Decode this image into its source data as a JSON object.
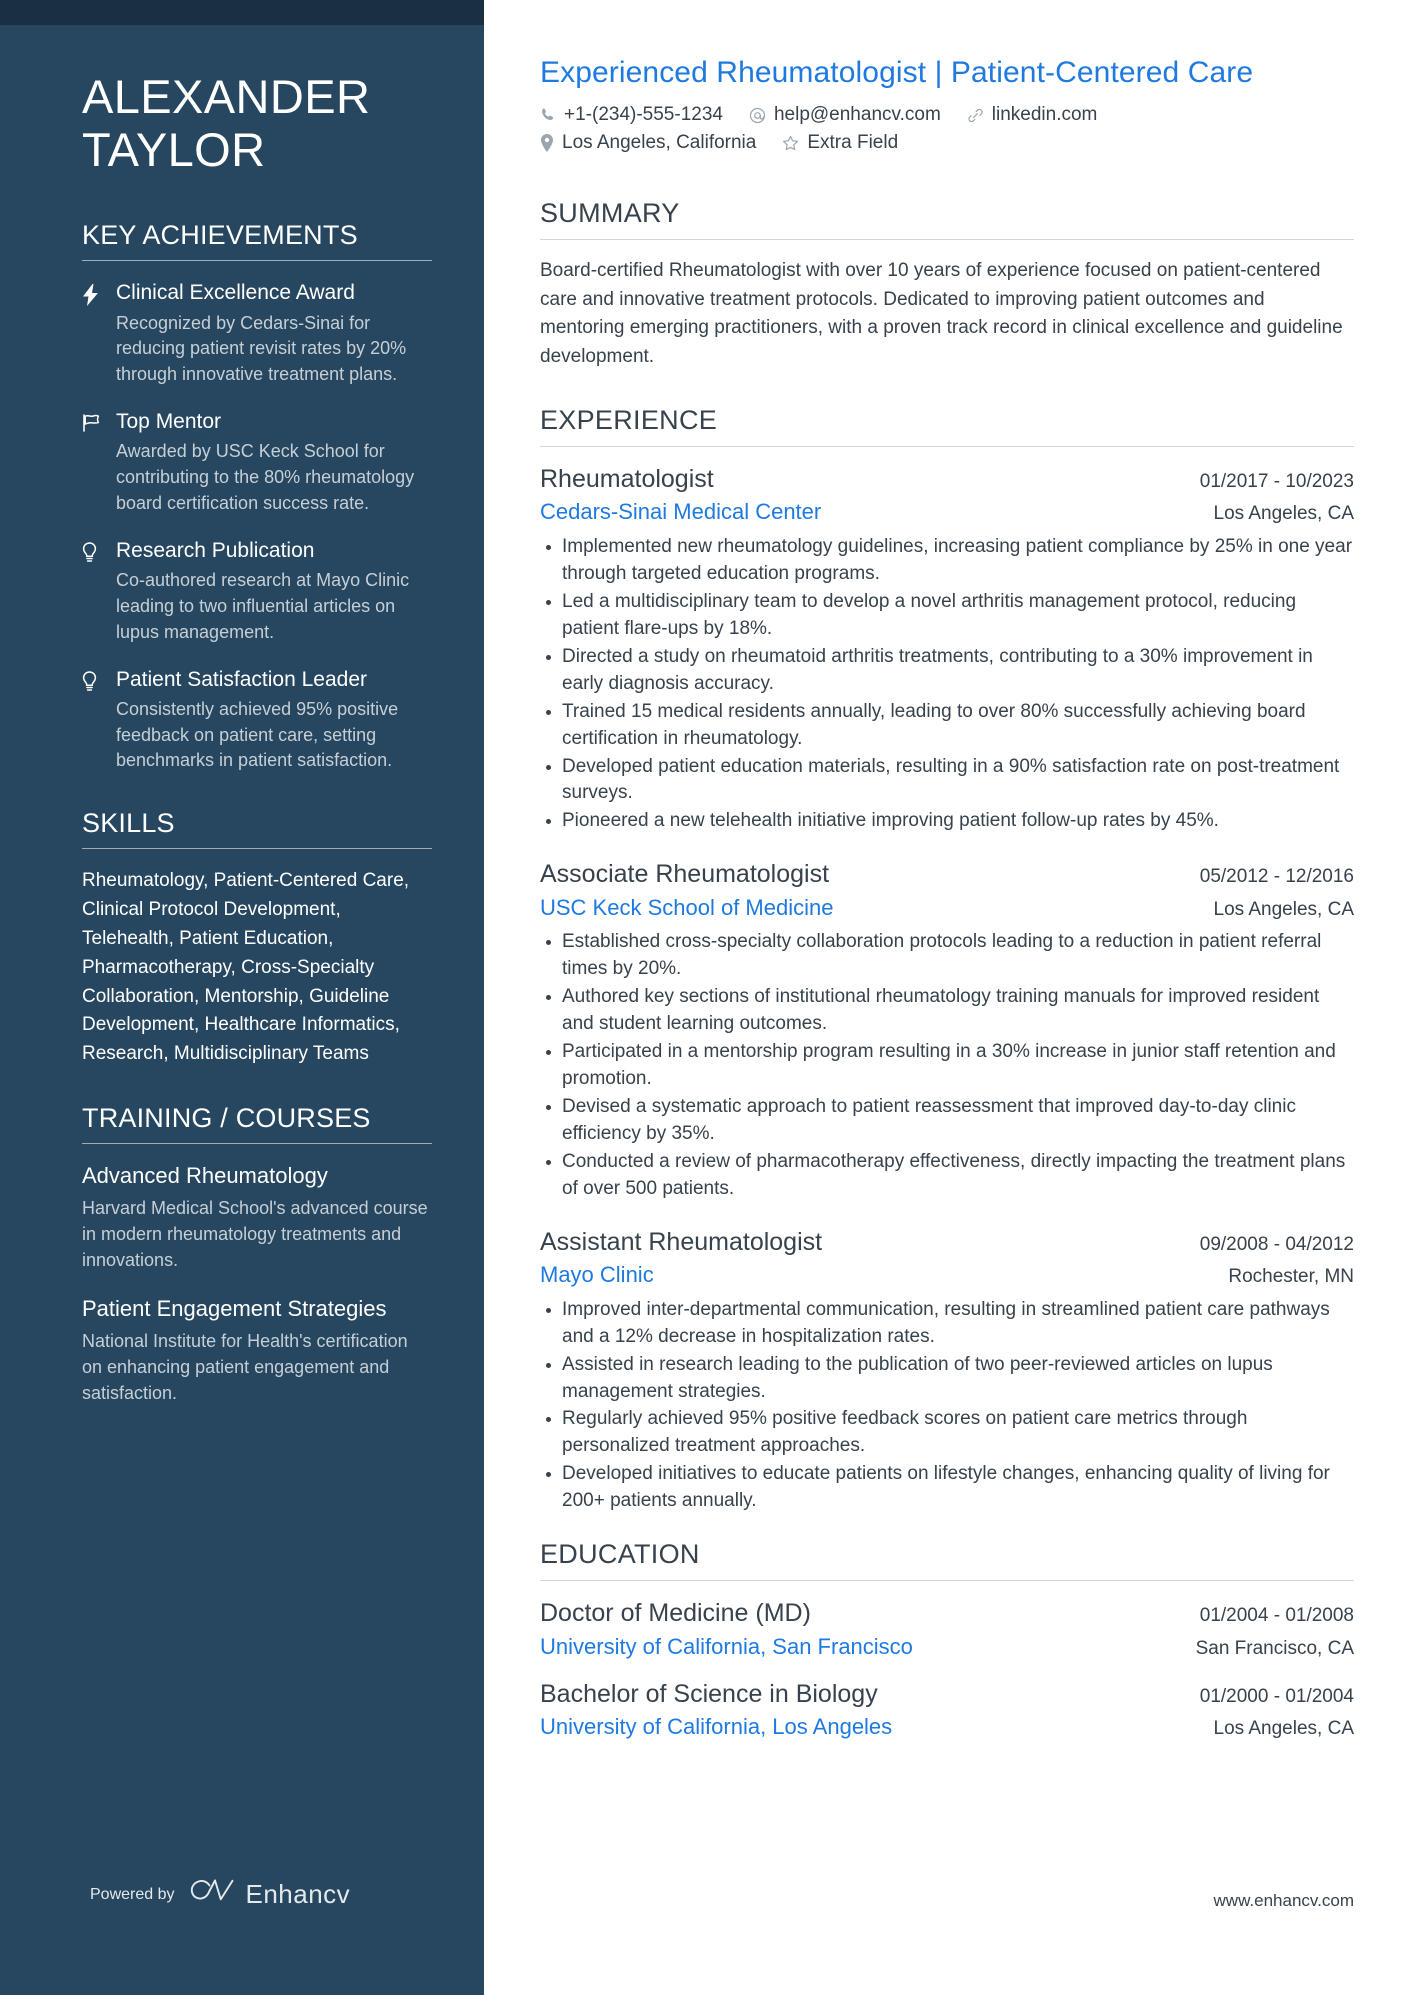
{
  "sidebar": {
    "name_lines": [
      "ALEXANDER",
      "TAYLOR"
    ],
    "achievements_heading": "KEY ACHIEVEMENTS",
    "achievements": [
      {
        "icon": "lightning-bolt-icon",
        "title": "Clinical Excellence Award",
        "desc": "Recognized by Cedars-Sinai for reducing patient revisit rates by 20% through innovative treatment plans."
      },
      {
        "icon": "flag-icon",
        "title": "Top Mentor",
        "desc": "Awarded by USC Keck School for contributing to the 80% rheumatology board certification success rate."
      },
      {
        "icon": "lightbulb-icon",
        "title": "Research Publication",
        "desc": "Co-authored research at Mayo Clinic leading to two influential articles on lupus management."
      },
      {
        "icon": "lightbulb-icon",
        "title": "Patient Satisfaction Leader",
        "desc": "Consistently achieved 95% positive feedback on patient care, setting benchmarks in patient satisfaction."
      }
    ],
    "skills_heading": "SKILLS",
    "skills_text": "Rheumatology, Patient-Centered Care, Clinical Protocol Development, Telehealth, Patient Education, Pharmacotherapy, Cross-Specialty Collaboration, Mentorship, Guideline Development, Healthcare Informatics, Research, Multidisciplinary Teams",
    "training_heading": "TRAINING / COURSES",
    "courses": [
      {
        "title": "Advanced Rheumatology",
        "desc": "Harvard Medical School's advanced course in modern rheumatology treatments and innovations."
      },
      {
        "title": "Patient Engagement Strategies",
        "desc": "National Institute for Health's certification on enhancing patient engagement and satisfaction."
      }
    ],
    "powered_by_label": "Powered by",
    "powered_by_brand": "Enhancv"
  },
  "header": {
    "headline": "Experienced Rheumatologist | Patient-Centered Care",
    "contact_row1": [
      {
        "icon": "phone-icon",
        "text": "+1-(234)-555-1234"
      },
      {
        "icon": "at-sign-icon",
        "text": "help@enhancv.com"
      },
      {
        "icon": "link-icon",
        "text": "linkedin.com"
      }
    ],
    "contact_row2": [
      {
        "icon": "map-pin-icon",
        "text": "Los Angeles, California"
      },
      {
        "icon": "star-icon",
        "text": "Extra Field"
      }
    ]
  },
  "summary": {
    "heading": "SUMMARY",
    "text": "Board-certified Rheumatologist with over 10 years of experience focused on patient-centered care and innovative treatment protocols. Dedicated to improving patient outcomes and mentoring emerging practitioners, with a proven track record in clinical excellence and guideline development."
  },
  "experience": {
    "heading": "EXPERIENCE",
    "entries": [
      {
        "title": "Rheumatologist",
        "date": "01/2017 - 10/2023",
        "org": "Cedars-Sinai Medical Center",
        "location": "Los Angeles, CA",
        "bullets": [
          "Implemented new rheumatology guidelines, increasing patient compliance by 25% in one year through targeted education programs.",
          "Led a multidisciplinary team to develop a novel arthritis management protocol, reducing patient flare-ups by 18%.",
          "Directed a study on rheumatoid arthritis treatments, contributing to a 30% improvement in early diagnosis accuracy.",
          "Trained 15 medical residents annually, leading to over 80% successfully achieving board certification in rheumatology.",
          "Developed patient education materials, resulting in a 90% satisfaction rate on post-treatment surveys.",
          "Pioneered a new telehealth initiative improving patient follow-up rates by 45%."
        ]
      },
      {
        "title": "Associate Rheumatologist",
        "date": "05/2012 - 12/2016",
        "org": "USC Keck School of Medicine",
        "location": "Los Angeles, CA",
        "bullets": [
          "Established cross-specialty collaboration protocols leading to a reduction in patient referral times by 20%.",
          "Authored key sections of institutional rheumatology training manuals for improved resident and student learning outcomes.",
          "Participated in a mentorship program resulting in a 30% increase in junior staff retention and promotion.",
          "Devised a systematic approach to patient reassessment that improved day-to-day clinic efficiency by 35%.",
          "Conducted a review of pharmacotherapy effectiveness, directly impacting the treatment plans of over 500 patients."
        ]
      },
      {
        "title": "Assistant Rheumatologist",
        "date": "09/2008 - 04/2012",
        "org": "Mayo Clinic",
        "location": "Rochester, MN",
        "bullets": [
          "Improved inter-departmental communication, resulting in streamlined patient care pathways and a 12% decrease in hospitalization rates.",
          "Assisted in research leading to the publication of two peer-reviewed articles on lupus management strategies.",
          "Regularly achieved 95% positive feedback scores on patient care metrics through personalized treatment approaches.",
          "Developed initiatives to educate patients on lifestyle changes, enhancing quality of living for 200+ patients annually."
        ]
      }
    ]
  },
  "education": {
    "heading": "EDUCATION",
    "entries": [
      {
        "title": "Doctor of Medicine (MD)",
        "date": "01/2004 - 01/2008",
        "org": "University of California, San Francisco",
        "location": "San Francisco, CA"
      },
      {
        "title": "Bachelor of Science in Biology",
        "date": "01/2000 - 01/2004",
        "org": "University of California, Los Angeles",
        "location": "Los Angeles, CA"
      }
    ]
  },
  "footer": {
    "website": "www.enhancv.com"
  },
  "colors": {
    "sidebar_bg": "#26475f",
    "sidebar_topbar": "#1b2f42",
    "accent_blue": "#1f7ae0",
    "body_text": "#37424c"
  }
}
